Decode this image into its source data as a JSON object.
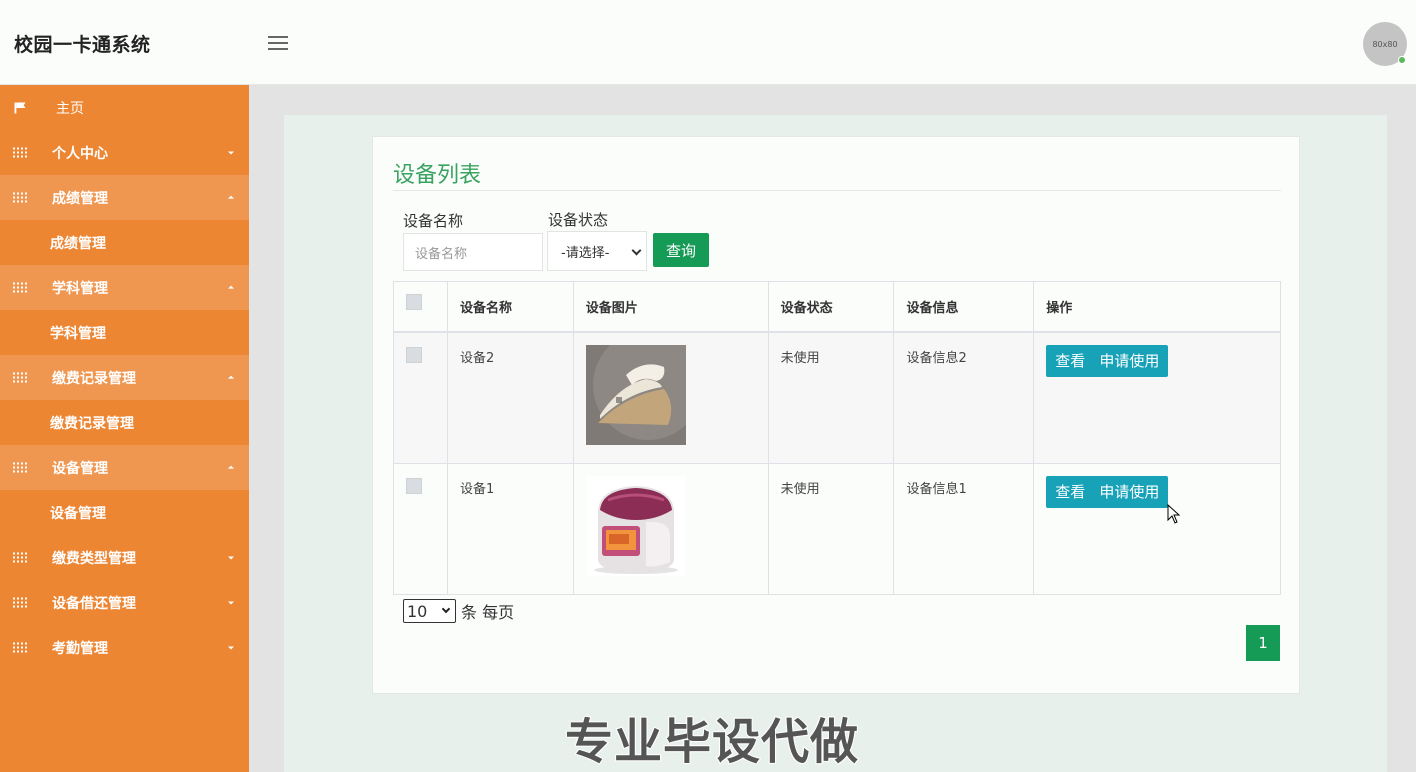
{
  "header": {
    "app_title": "校园一卡通系统",
    "avatar_text": "80x80"
  },
  "sidebar": {
    "items": [
      {
        "label": "主页",
        "icon": "flag-icon",
        "caret": ""
      },
      {
        "label": "个人中心",
        "icon": "grid-icon",
        "caret": "down"
      },
      {
        "label": "成绩管理",
        "icon": "grid-icon",
        "caret": "up",
        "sub": "成绩管理"
      },
      {
        "label": "学科管理",
        "icon": "grid-icon",
        "caret": "up",
        "sub": "学科管理"
      },
      {
        "label": "缴费记录管理",
        "icon": "grid-icon",
        "caret": "up",
        "sub": "缴费记录管理"
      },
      {
        "label": "设备管理",
        "icon": "grid-icon",
        "caret": "up",
        "sub": "设备管理"
      },
      {
        "label": "缴费类型管理",
        "icon": "grid-icon",
        "caret": "down"
      },
      {
        "label": "设备借还管理",
        "icon": "grid-icon",
        "caret": "down"
      },
      {
        "label": "考勤管理",
        "icon": "grid-icon",
        "caret": "down"
      }
    ]
  },
  "main": {
    "title": "设备列表",
    "filters": {
      "name_label": "设备名称",
      "name_placeholder": "设备名称",
      "status_label": "设备状态",
      "status_selected": "-请选择-",
      "query_button": "查询"
    },
    "table": {
      "headers": [
        "设备名称",
        "设备图片",
        "设备状态",
        "设备信息",
        "操作"
      ],
      "rows": [
        {
          "name": "设备2",
          "image": "iron-image",
          "status": "未使用",
          "info": "设备信息2",
          "view": "查看",
          "apply": "申请使用"
        },
        {
          "name": "设备1",
          "image": "rice-cooker-image",
          "status": "未使用",
          "info": "设备信息1",
          "view": "查看",
          "apply": "申请使用"
        }
      ]
    },
    "pagination": {
      "page_size": "10",
      "per_page_text": "条 每页",
      "current_page": "1"
    }
  },
  "watermark": "专业毕设代做",
  "colors": {
    "sidebar": "#ec8633",
    "primary_green": "#169b57",
    "title_green": "#3aa361",
    "action_teal": "#17a2b8"
  }
}
